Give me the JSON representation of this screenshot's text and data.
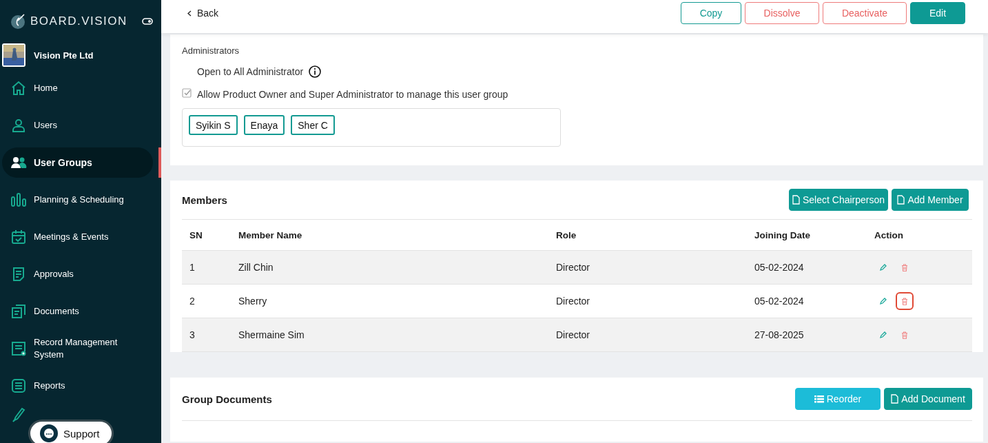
{
  "sidebar": {
    "brand": "BOARD.VISION",
    "organization": "Vision Pte Ltd",
    "items": [
      {
        "label": "Home",
        "kind": "home",
        "selected": false
      },
      {
        "label": "Users",
        "kind": "user",
        "selected": false
      },
      {
        "label": "User Groups",
        "kind": "group",
        "selected": true
      },
      {
        "label": "Planning & Scheduling",
        "kind": "bars",
        "selected": false
      },
      {
        "label": "Meetings & Events",
        "kind": "calendar",
        "selected": false
      },
      {
        "label": "Approvals",
        "kind": "doc",
        "selected": false
      },
      {
        "label": "Documents",
        "kind": "docs",
        "selected": false
      },
      {
        "label": "Record Management System",
        "kind": "record",
        "selected": false
      },
      {
        "label": "Reports",
        "kind": "list",
        "selected": false
      }
    ],
    "support": "Support"
  },
  "top_bar": {
    "back": "Back",
    "buttons": [
      {
        "label": "Copy",
        "kind": "outline"
      },
      {
        "label": "Dissolve",
        "kind": "danger"
      },
      {
        "label": "Deactivate",
        "kind": "danger"
      },
      {
        "label": "Edit",
        "kind": "primary"
      }
    ]
  },
  "administrators": {
    "title": "Administrators",
    "open_to_all": "Open to All Administrator",
    "allow": {
      "label": "Allow Product Owner and Super Administrator to manage this user group",
      "checked": true
    },
    "chips": [
      "Syikin S",
      "Enaya",
      "Sher C"
    ]
  },
  "members": {
    "title": "Members",
    "buttons": [
      {
        "label": "Select Chairperson",
        "kind": "primary"
      },
      {
        "label": "Add Member",
        "kind": "primary"
      }
    ],
    "columns": [
      "SN",
      "Member Name",
      "Role",
      "Joining Date",
      "Action"
    ],
    "rows": [
      {
        "sn": "1",
        "name": "Zill Chin",
        "role": "Director",
        "date": "05-02-2024",
        "highlighted": false
      },
      {
        "sn": "2",
        "name": "Sherry",
        "role": "Director",
        "date": "05-02-2024",
        "highlighted": true
      },
      {
        "sn": "3",
        "name": "Shermaine Sim",
        "role": "Director",
        "date": "27-08-2025",
        "highlighted": false
      }
    ]
  },
  "group_documents": {
    "title": "Group Documents",
    "buttons": [
      {
        "label": "Reorder",
        "kind": "info"
      },
      {
        "label": "Add Document",
        "kind": "primary"
      }
    ]
  }
}
